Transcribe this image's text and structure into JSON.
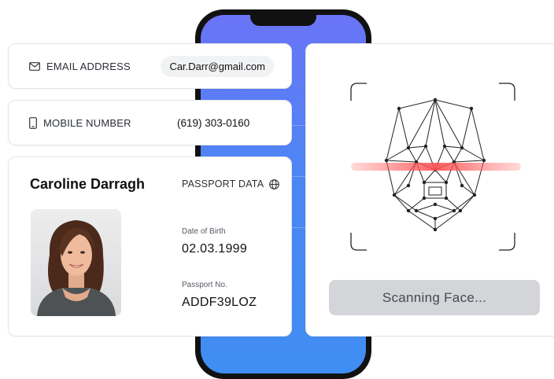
{
  "contact": {
    "email_label": "EMAIL ADDRESS",
    "email_value": "Car.Darr@gmail.com",
    "mobile_label": "MOBILE NUMBER",
    "mobile_value": "(619) 303-0160"
  },
  "passport": {
    "name": "Caroline Darragh",
    "section_label": "PASSPORT DATA",
    "dob_label": "Date of Birth",
    "dob_value": "02.03.1999",
    "passport_no_label": "Passport No.",
    "passport_no_value": "ADDF39LOZ"
  },
  "scan": {
    "status_label": "Scanning Face..."
  },
  "icons": {
    "email": "envelope-icon",
    "mobile": "phone-icon",
    "passport": "globe-icon"
  },
  "colors": {
    "phone_gradient_top": "#6a74f6",
    "phone_gradient_bottom": "#3f8ef3",
    "scan_line": "#ff4d4d",
    "button_bg": "#d4d5d8"
  }
}
